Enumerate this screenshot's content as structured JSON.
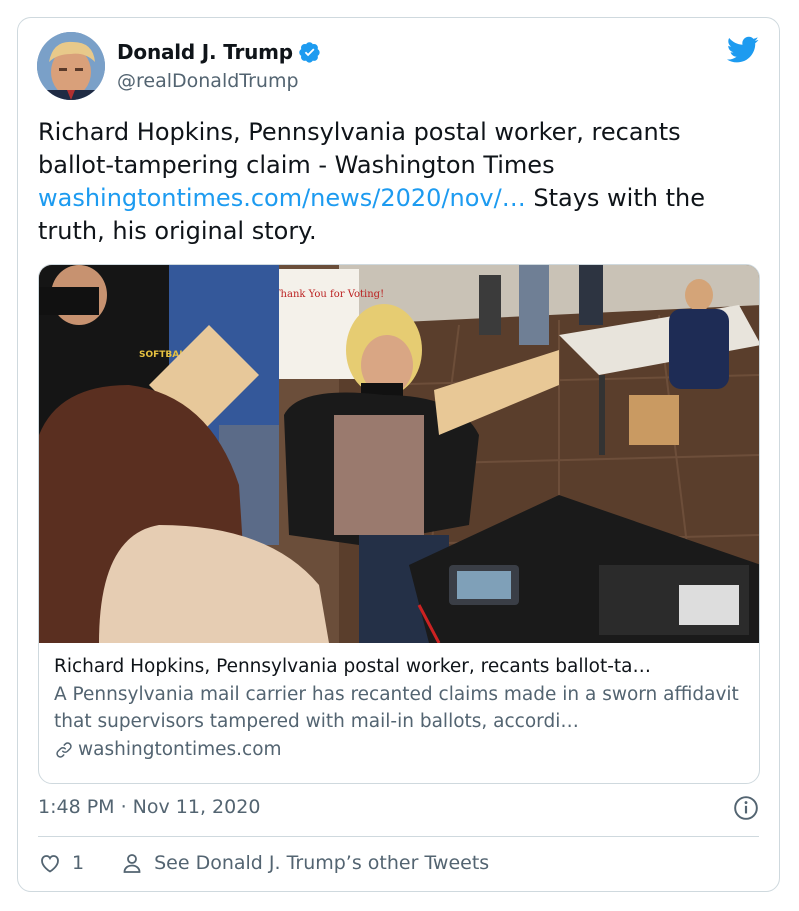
{
  "author": {
    "name": "Donald J. Trump",
    "handle": "@realDonaldTrump"
  },
  "tweet": {
    "text_part1": "Richard Hopkins, Pennsylvania postal worker, recants ballot-tampering claim - Washington Times ",
    "link_text": "washingtontimes.com/news/2020/nov/…",
    "text_part2": "  Stays with the truth, his original story."
  },
  "link_card": {
    "title": "Richard Hopkins, Pennsylvania postal worker, recants ballot-ta…",
    "description": "A Pennsylvania mail carrier has recanted claims made in a sworn affidavit that supervisors tampered with mail-in ballots, accordi…",
    "domain": "washingtontimes.com",
    "photo_sign_text": "Thank You for Voting!",
    "jacket_text": "SOFTBALL COACH"
  },
  "meta": {
    "timestamp": "1:48 PM · Nov 11, 2020"
  },
  "actions": {
    "like_count": "1",
    "profile_link": "See Donald J. Trump’s other Tweets"
  },
  "colors": {
    "accent": "#1d9bf0",
    "muted": "#536471",
    "border": "#cfd9de"
  }
}
